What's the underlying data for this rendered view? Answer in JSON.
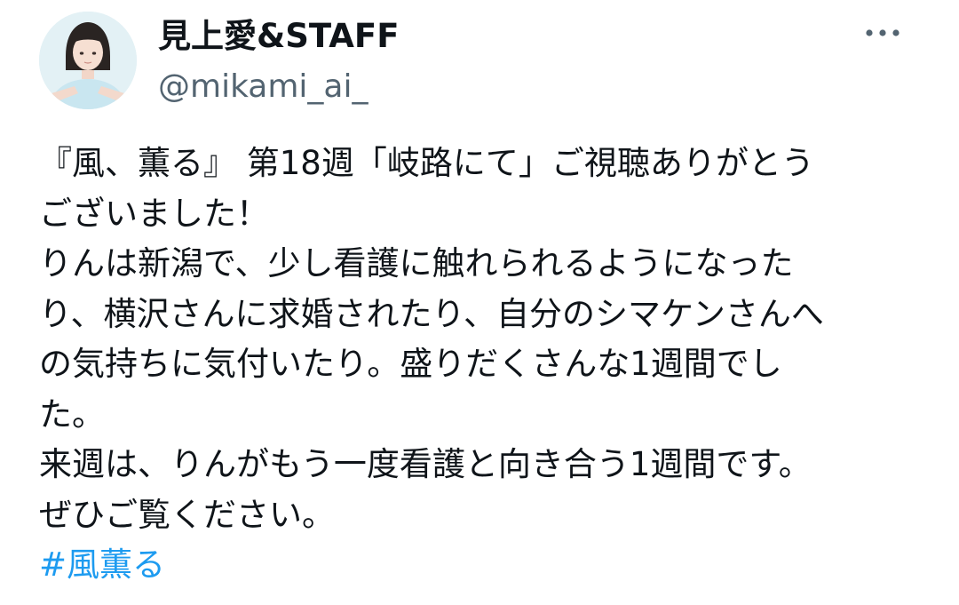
{
  "author": {
    "display_name": "見上愛&STAFF",
    "handle": "@mikami_ai_",
    "avatar_icon": "profile-photo-avatar"
  },
  "more_icon": "more-horizontal-icon",
  "tweet": {
    "lines": [
      "『風、薫る』 第18週「岐路にて」ご視聴ありがとう",
      "ございました！",
      "りんは新潟で、少し看護に触れられるようになった",
      "り、横沢さんに求婚されたり、自分のシマケンさんへ",
      "の気持ちに気付いたり。盛りだくさんな1週間でし",
      "た。",
      "来週は、りんがもう一度看護と向き合う1週間です。",
      "ぜひご覧ください。"
    ],
    "hashtag": "#風薫る"
  },
  "colors": {
    "text": "#0f1419",
    "secondary_text": "#536471",
    "link": "#1d9bf0"
  }
}
